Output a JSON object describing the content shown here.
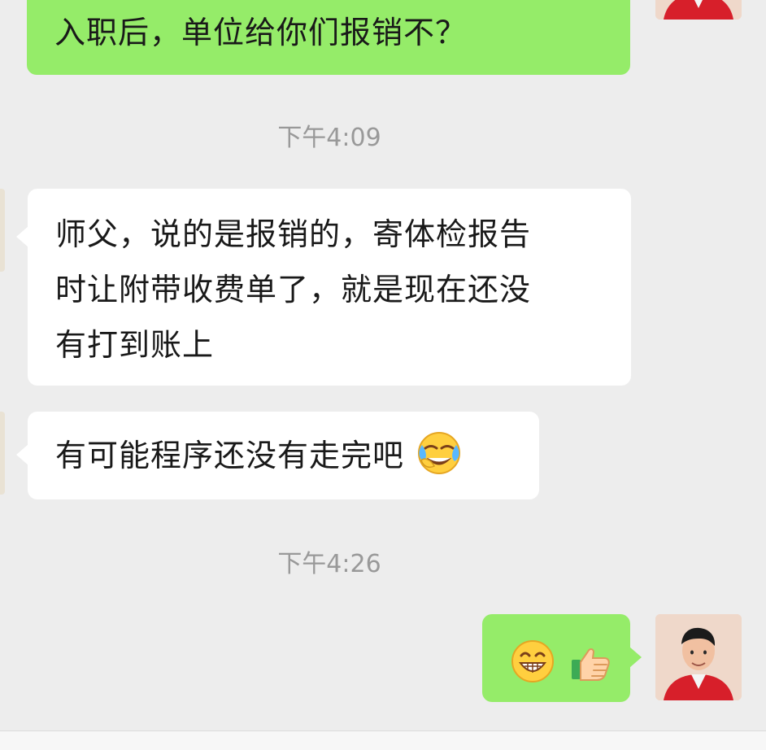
{
  "messages": [
    {
      "direction": "outgoing",
      "text": "入职后，单位给你们报销不？"
    },
    {
      "type": "timestamp",
      "text": "下午4:09"
    },
    {
      "direction": "incoming",
      "lines": [
        "师父，说的是报销的，寄体检报告",
        "时让附带收费单了，就是现在还没",
        "有打到账上"
      ]
    },
    {
      "direction": "incoming",
      "text": "有可能程序还没有走完吧",
      "emoji": "laugh-crying-emoji"
    },
    {
      "type": "timestamp",
      "text": "下午4:26"
    },
    {
      "direction": "outgoing",
      "emojis": [
        "grinning-emoji",
        "thumbs-up-emoji"
      ]
    }
  ],
  "colors": {
    "background": "#ededed",
    "outgoing_bubble": "#95ec69",
    "incoming_bubble": "#ffffff",
    "timestamp_text": "#999999",
    "message_text": "#191919"
  }
}
